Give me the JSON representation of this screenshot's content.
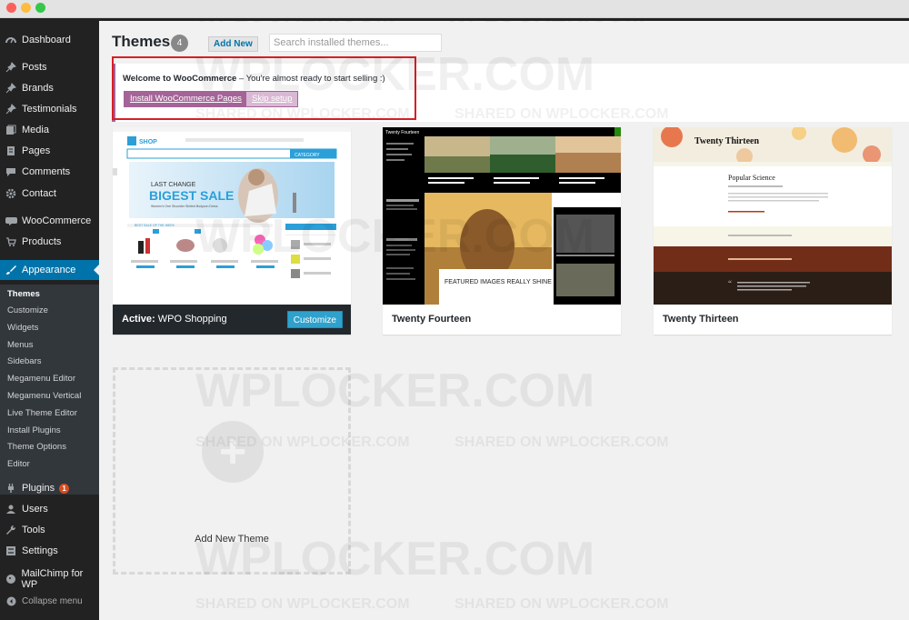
{
  "colors": {
    "sidebar": "#222222",
    "accent": "#0073aa",
    "woo": "#a46497",
    "alert_outline": "#d61f26"
  },
  "sidebar": {
    "items": [
      {
        "label": "Dashboard",
        "icon": "dashboard-icon"
      },
      {
        "label": "Posts",
        "icon": "pin-icon"
      },
      {
        "label": "Brands",
        "icon": "pin-icon"
      },
      {
        "label": "Testimonials",
        "icon": "pin-icon"
      },
      {
        "label": "Media",
        "icon": "media-icon"
      },
      {
        "label": "Pages",
        "icon": "page-icon"
      },
      {
        "label": "Comments",
        "icon": "comment-icon"
      },
      {
        "label": "Contact",
        "icon": "gear-icon"
      },
      {
        "label": "WooCommerce",
        "icon": "woo-icon"
      },
      {
        "label": "Products",
        "icon": "cart-icon"
      },
      {
        "label": "Appearance",
        "icon": "brush-icon"
      }
    ],
    "submenu": [
      "Themes",
      "Customize",
      "Widgets",
      "Menus",
      "Sidebars",
      "Megamenu Editor",
      "Megamenu Vertical",
      "Live Theme Editor",
      "Install Plugins",
      "Theme Options",
      "Editor"
    ],
    "items2": [
      {
        "label": "Plugins",
        "icon": "plugin-icon",
        "badge": "1"
      },
      {
        "label": "Users",
        "icon": "user-icon"
      },
      {
        "label": "Tools",
        "icon": "wrench-icon"
      },
      {
        "label": "Settings",
        "icon": "settings-icon"
      },
      {
        "label": "MailChimp for WP",
        "icon": "mailchimp-icon"
      }
    ],
    "collapse": "Collapse menu"
  },
  "header": {
    "title": "Themes",
    "count": "4",
    "add_new": "Add New",
    "search_placeholder": "Search installed themes..."
  },
  "notice": {
    "title": "Welcome to WooCommerce",
    "text": " – You're almost ready to start selling :)",
    "primary_button": "Install WooCommerce Pages",
    "secondary_button": "Skip setup"
  },
  "themes": [
    {
      "active_prefix": "Active:",
      "name": "WPO Shopping",
      "customize": "Customize",
      "shot": {
        "logo": "SHOP",
        "banner_line1": "LAST CHANGE",
        "banner_line2": "BIGEST SALE",
        "banner_line3": "Women's One Shoulder Skirted Bodycon Dress",
        "category": "CATEGORY",
        "best_sale": "BEST SALE OF THE WEEK"
      }
    },
    {
      "name": "Twenty Fourteen",
      "shot": {
        "site_title": "Twenty Fourteen",
        "featured": "FEATURED IMAGES REALLY SHINE IN THIS THEME"
      }
    },
    {
      "name": "Twenty Thirteen",
      "shot": {
        "site_title": "Twenty Thirteen",
        "post_title": "Popular Science"
      }
    }
  ],
  "add_theme": {
    "label": "Add New Theme"
  },
  "watermark": {
    "big": "WPLOCKER.COM",
    "small": "SHARED ON WPLOCKER.COM"
  }
}
